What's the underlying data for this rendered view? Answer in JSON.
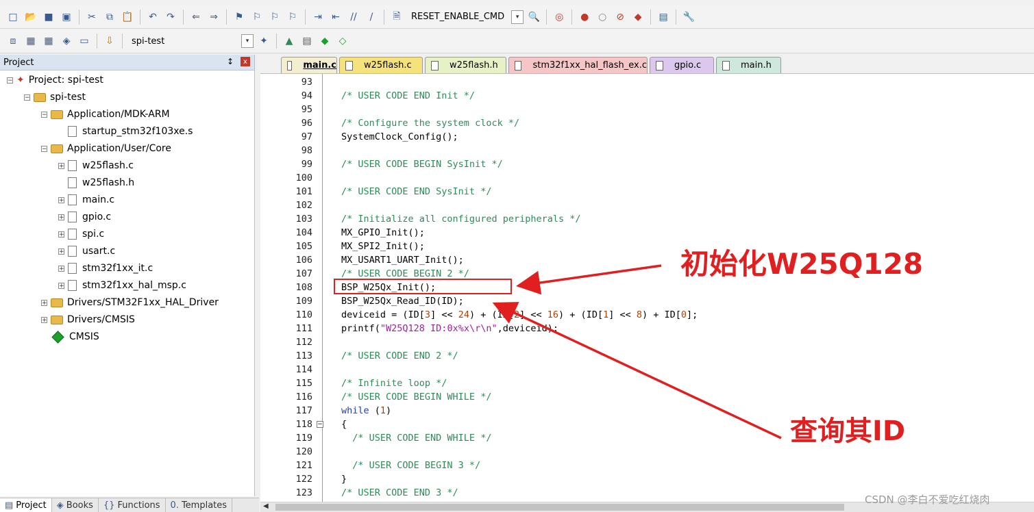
{
  "toolbar1": {
    "command_label": "RESET_ENABLE_CMD",
    "icons": [
      "new-file-icon",
      "open-icon",
      "save-icon",
      "save-all-icon",
      "cut-icon",
      "copy-icon",
      "paste-icon",
      "undo-icon",
      "redo-icon",
      "back-icon",
      "forward-icon",
      "bookmark-icon",
      "prev-bookmark-icon",
      "next-bookmark-icon",
      "clear-bookmarks-icon",
      "indent-icon",
      "unindent-icon",
      "comment-icon",
      "uncomment-icon",
      "find-in-files-icon",
      "find-icon",
      "debug-icon",
      "breakpoint-icon",
      "disable-breakpoint-icon",
      "kill-breakpoints-icon",
      "clear-breakpoints-icon",
      "window-icon",
      "configure-icon"
    ]
  },
  "toolbar2": {
    "target_label": "spi-test",
    "icons": [
      "translate-icon",
      "build-icon",
      "rebuild-icon",
      "batch-build-icon",
      "stop-build-icon",
      "load-icon",
      "options-icon",
      "manage-components-icon",
      "select-pack-icon",
      "pack-installer-icon",
      "rte-icon"
    ]
  },
  "project_panel": {
    "title": "Project",
    "pin": "↕",
    "close": "x",
    "tree": [
      {
        "label": "Project: spi-test",
        "depth": 0,
        "kind": "project",
        "expander": "−"
      },
      {
        "label": "spi-test",
        "depth": 1,
        "kind": "target",
        "expander": "−"
      },
      {
        "label": "Application/MDK-ARM",
        "depth": 2,
        "kind": "folder",
        "expander": "−"
      },
      {
        "label": "startup_stm32f103xe.s",
        "depth": 3,
        "kind": "file",
        "expander": ""
      },
      {
        "label": "Application/User/Core",
        "depth": 2,
        "kind": "folder",
        "expander": "−"
      },
      {
        "label": "w25flash.c",
        "depth": 3,
        "kind": "file",
        "expander": "+"
      },
      {
        "label": "w25flash.h",
        "depth": 3,
        "kind": "file",
        "expander": ""
      },
      {
        "label": "main.c",
        "depth": 3,
        "kind": "file",
        "expander": "+"
      },
      {
        "label": "gpio.c",
        "depth": 3,
        "kind": "file",
        "expander": "+"
      },
      {
        "label": "spi.c",
        "depth": 3,
        "kind": "file",
        "expander": "+"
      },
      {
        "label": "usart.c",
        "depth": 3,
        "kind": "file",
        "expander": "+"
      },
      {
        "label": "stm32f1xx_it.c",
        "depth": 3,
        "kind": "file",
        "expander": "+"
      },
      {
        "label": "stm32f1xx_hal_msp.c",
        "depth": 3,
        "kind": "file",
        "expander": "+"
      },
      {
        "label": "Drivers/STM32F1xx_HAL_Driver",
        "depth": 2,
        "kind": "folder",
        "expander": "+"
      },
      {
        "label": "Drivers/CMSIS",
        "depth": 2,
        "kind": "folder",
        "expander": "+"
      },
      {
        "label": "CMSIS",
        "depth": 2,
        "kind": "component",
        "expander": ""
      }
    ]
  },
  "bottom_tabs": [
    "Project",
    "Books",
    "Functions",
    "Templates"
  ],
  "editor_tabs": [
    {
      "label": "main.c",
      "color": "#f4eed0",
      "active": true
    },
    {
      "label": "w25flash.c",
      "color": "#f5e27a",
      "active": false
    },
    {
      "label": "w25flash.h",
      "color": "#e7f1c6",
      "active": false
    },
    {
      "label": "stm32f1xx_hal_flash_ex.c",
      "color": "#f6c6c6",
      "active": false
    },
    {
      "label": "gpio.c",
      "color": "#dcc8ec",
      "active": false
    },
    {
      "label": "main.h",
      "color": "#cfe8dc",
      "active": false
    }
  ],
  "code_lines": [
    {
      "n": "93",
      "text": ""
    },
    {
      "n": "94",
      "text": "/* USER CODE END Init */"
    },
    {
      "n": "95",
      "text": ""
    },
    {
      "n": "96",
      "text": "/* Configure the system clock */"
    },
    {
      "n": "97",
      "text": "SystemClock_Config();"
    },
    {
      "n": "98",
      "text": ""
    },
    {
      "n": "99",
      "text": "/* USER CODE BEGIN SysInit */"
    },
    {
      "n": "100",
      "text": ""
    },
    {
      "n": "101",
      "text": "/* USER CODE END SysInit */"
    },
    {
      "n": "102",
      "text": ""
    },
    {
      "n": "103",
      "text": "/* Initialize all configured peripherals */"
    },
    {
      "n": "104",
      "text": "MX_GPIO_Init();"
    },
    {
      "n": "105",
      "text": "MX_SPI2_Init();"
    },
    {
      "n": "106",
      "text": "MX_USART1_UART_Init();"
    },
    {
      "n": "107",
      "text": "/* USER CODE BEGIN 2 */"
    },
    {
      "n": "108",
      "text": "BSP_W25Qx_Init();"
    },
    {
      "n": "109",
      "text": "BSP_W25Qx_Read_ID(ID);"
    },
    {
      "n": "110",
      "text": "deviceid = (ID[3] << 24) + (ID[2] << 16) + (ID[1] << 8) + ID[0];"
    },
    {
      "n": "111",
      "text": "printf(\"W25Q128 ID:0x%x\\r\\n\",deviceid);"
    },
    {
      "n": "112",
      "text": ""
    },
    {
      "n": "113",
      "text": "/* USER CODE END 2 */"
    },
    {
      "n": "114",
      "text": ""
    },
    {
      "n": "115",
      "text": "/* Infinite loop */"
    },
    {
      "n": "116",
      "text": "/* USER CODE BEGIN WHILE */"
    },
    {
      "n": "117",
      "text": "while (1)"
    },
    {
      "n": "118",
      "text": "{"
    },
    {
      "n": "119",
      "text": "  /* USER CODE END WHILE */"
    },
    {
      "n": "120",
      "text": ""
    },
    {
      "n": "121",
      "text": "  /* USER CODE BEGIN 3 */"
    },
    {
      "n": "122",
      "text": "}"
    },
    {
      "n": "123",
      "text": "/* USER CODE END 3 */"
    }
  ],
  "annotations": {
    "init_label": "初始化W25Q128",
    "query_label": "查询其ID"
  },
  "watermark": "CSDN @李白不爱吃红烧肉",
  "colors": {
    "comment": "#2e8b57",
    "keyword": "#1f3fbf",
    "string": "#a020a0",
    "annotation_red": "#e02020",
    "current_line": "#e9f7ea"
  }
}
